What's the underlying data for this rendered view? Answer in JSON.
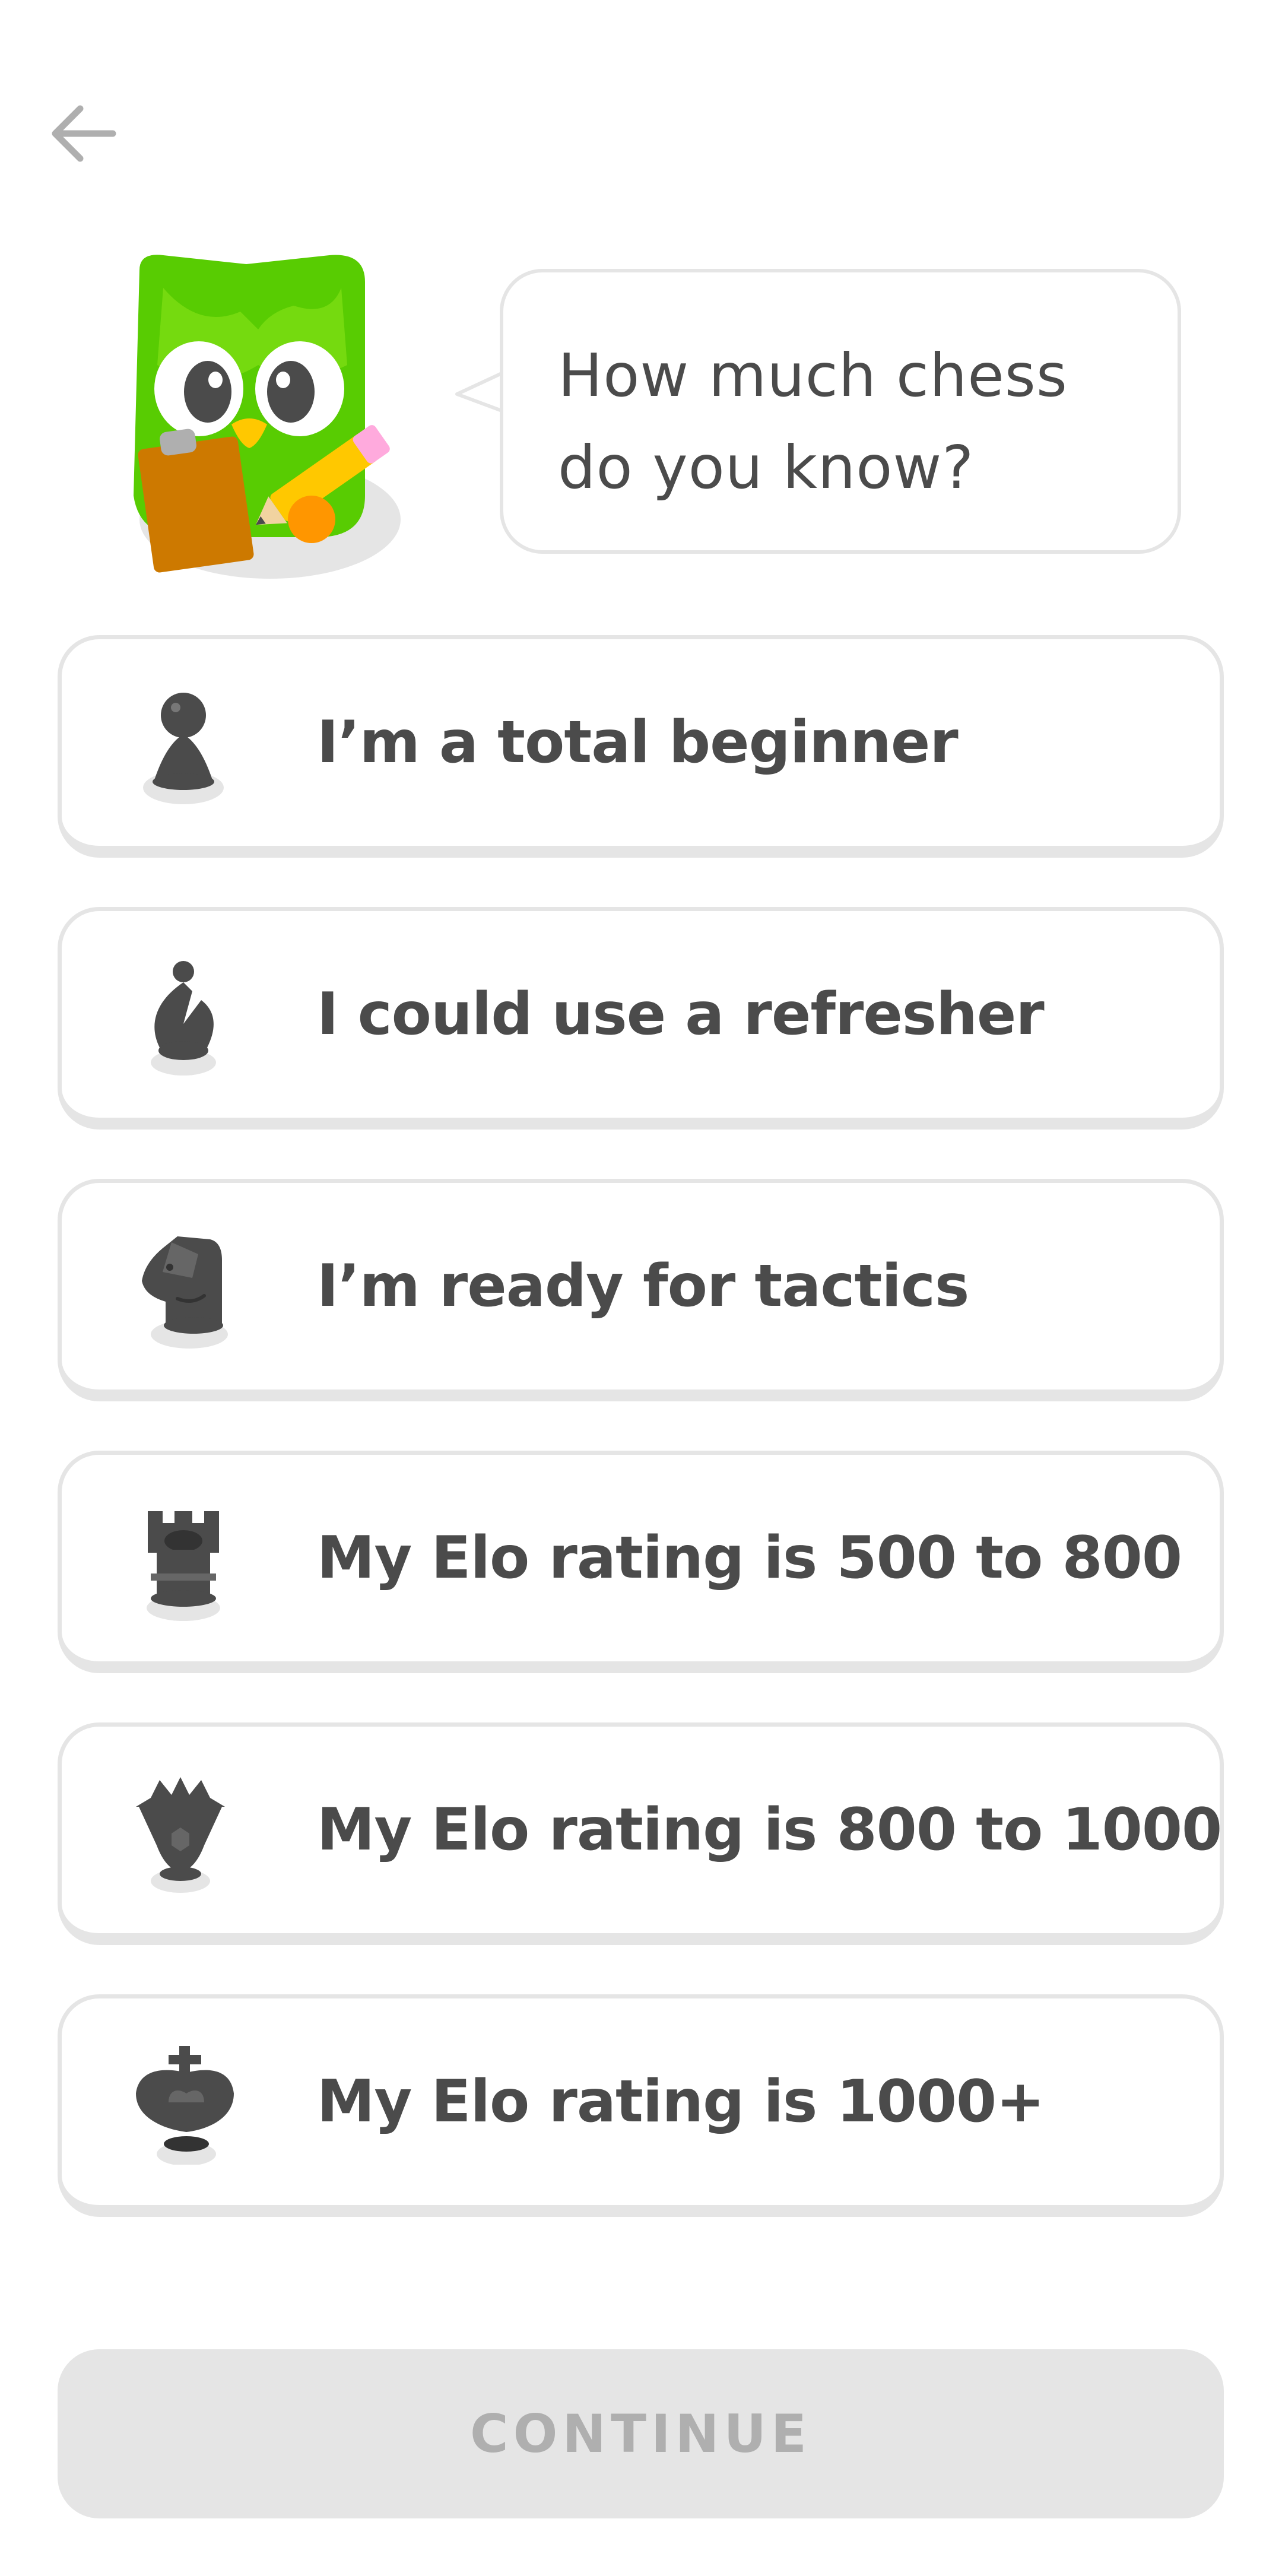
{
  "header": {
    "back_icon": "arrow-left-icon"
  },
  "mascot": {
    "icon": "owl-mascot-with-clipboard-and-pencil",
    "body_color": "#58cc02"
  },
  "prompt": {
    "text": "How much chess do you know?"
  },
  "options": [
    {
      "icon": "pawn-icon",
      "label": "I’m a total beginner"
    },
    {
      "icon": "bishop-icon",
      "label": "I could use a refresher"
    },
    {
      "icon": "knight-icon",
      "label": "I’m ready for tactics"
    },
    {
      "icon": "rook-icon",
      "label": "My Elo rating is 500 to 800"
    },
    {
      "icon": "queen-icon",
      "label": "My Elo rating is 800 to 1000"
    },
    {
      "icon": "king-icon",
      "label": "My Elo rating is 1000+"
    }
  ],
  "footer": {
    "continue_label": "CONTINUE"
  },
  "colors": {
    "text": "#4b4b4b",
    "border": "#e5e5e5",
    "disabled_bg": "#e5e5e5",
    "disabled_text": "#afafaf",
    "piece": "#4b4b4b"
  }
}
